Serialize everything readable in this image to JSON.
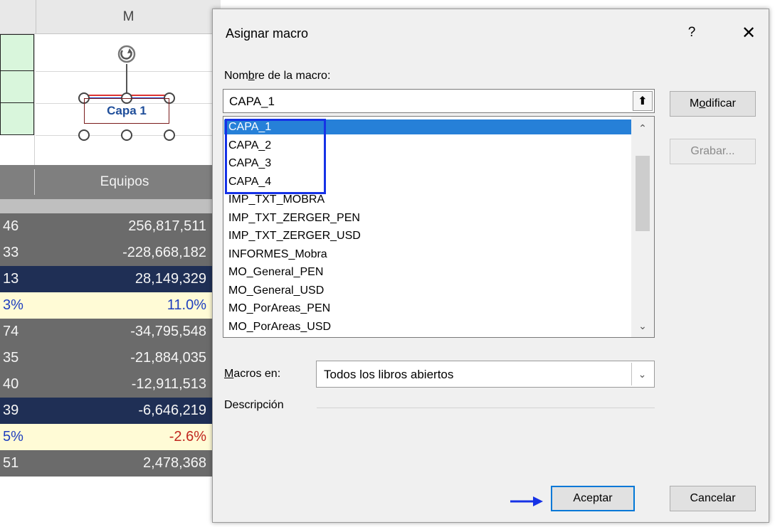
{
  "sheet": {
    "column_header": "M",
    "shape_label": "Capa 1",
    "header_row_label": "Equipos",
    "rows": [
      {
        "left": "46",
        "right": "256,817,511",
        "style": "gray"
      },
      {
        "left": "33",
        "right": "-228,668,182",
        "style": "gray"
      },
      {
        "left": "13",
        "right": "28,149,329",
        "style": "navy"
      },
      {
        "left": "3%",
        "right": "11.0%",
        "style": "yellow",
        "left_color": "#1f3fbf",
        "right_color": "#1f3fbf"
      },
      {
        "left": "74",
        "right": "-34,795,548",
        "style": "gray"
      },
      {
        "left": "35",
        "right": "-21,884,035",
        "style": "gray"
      },
      {
        "left": "40",
        "right": "-12,911,513",
        "style": "gray"
      },
      {
        "left": "39",
        "right": "-6,646,219",
        "style": "navy"
      },
      {
        "left": "5%",
        "right": "-2.6%",
        "style": "yellow",
        "left_color": "#1f3fbf",
        "right_color": "#c0261e"
      },
      {
        "left": "51",
        "right": "2,478,368",
        "style": "gray"
      }
    ]
  },
  "dialog": {
    "title": "Asignar macro",
    "help": "?",
    "close": "✕",
    "name_label_pre": "Nom",
    "name_label_accel": "b",
    "name_label_post": "re de la macro:",
    "name_value": "CAPA_1",
    "up_icon": "⬆",
    "macros": [
      "CAPA_1",
      "CAPA_2",
      "CAPA_3",
      "CAPA_4",
      "IMP_TXT_MOBRA",
      "IMP_TXT_ZERGER_PEN",
      "IMP_TXT_ZERGER_USD",
      "INFORMES_Mobra",
      "MO_General_PEN",
      "MO_General_USD",
      "MO_PorAreas_PEN",
      "MO_PorAreas_USD"
    ],
    "selected_index": 0,
    "scroll_up": "⌃",
    "scroll_down": "⌄",
    "macros_in_label_accel": "M",
    "macros_in_label_post": "acros en:",
    "macros_in_value": "Todos los libros abiertos",
    "combo_arrow": "⌄",
    "description_label": "Descripción",
    "buttons": {
      "modify_pre": "M",
      "modify_accel": "o",
      "modify_post": "dificar",
      "record": "Grabar...",
      "accept": "Aceptar",
      "cancel": "Cancelar"
    },
    "highlight_color": "#1632e6",
    "selection_color": "#2680d8"
  }
}
